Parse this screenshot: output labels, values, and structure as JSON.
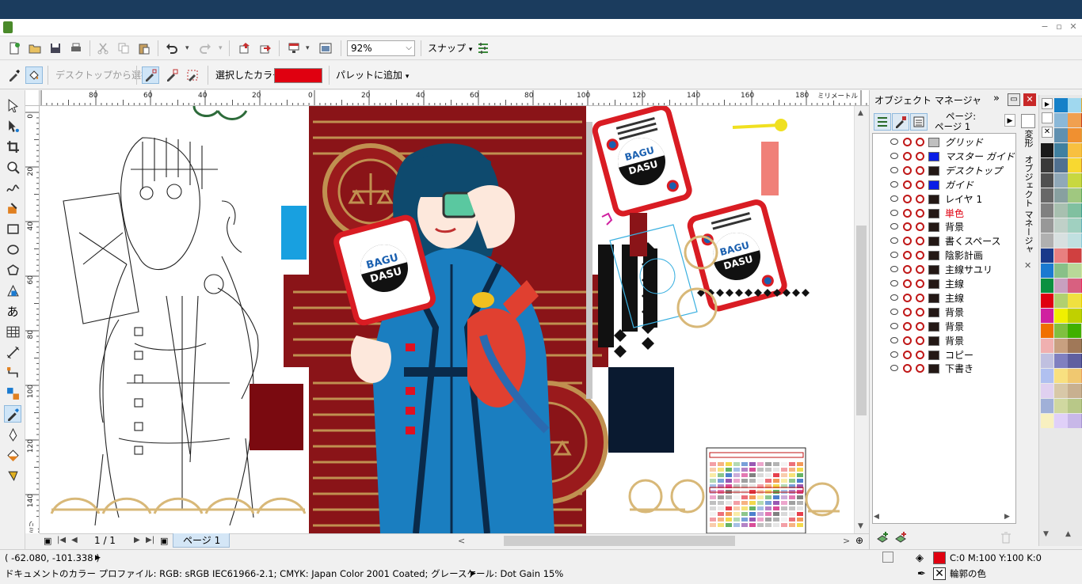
{
  "window": {
    "controls": [
      "−",
      "▫",
      "✕"
    ]
  },
  "toolbar": {
    "zoom": "92%",
    "snap_label": "スナップ"
  },
  "eyedropper_bar": {
    "desktop_select": "デスクトップから選択",
    "selected_color_label": "選択したカラー",
    "selected_color": "#e00010",
    "add_to_palette": "パレットに追加"
  },
  "ruler": {
    "h_ticks": [
      "80",
      "60",
      "40",
      "20",
      "0",
      "20",
      "40",
      "60",
      "80",
      "100",
      "120",
      "140",
      "160",
      "180"
    ],
    "h_unit": "ミリメートル",
    "v_ticks": [
      "0",
      "20",
      "40",
      "60",
      "80",
      "100",
      "120",
      "140"
    ],
    "v_unit": "ミリメートル"
  },
  "page_nav": {
    "counter": "1 / 1",
    "tab": "ページ 1"
  },
  "object_manager": {
    "title": "オブジェクト マネージャ",
    "page_header_line1": "ページ:",
    "page_header_line2": "ページ 1",
    "side_tab_1": "変形",
    "side_tab_2": "オブジェクト マネージャ",
    "layers": [
      {
        "name": "グリッド",
        "color": "#bfbfbf",
        "italic": true,
        "red": false
      },
      {
        "name": "マスター ガイド",
        "color": "#0a1ee6",
        "italic": true,
        "red": false
      },
      {
        "name": "デスクトップ",
        "color": "#231815",
        "italic": true,
        "red": false
      },
      {
        "name": "ガイド",
        "color": "#0a1ee6",
        "italic": true,
        "red": false
      },
      {
        "name": "レイヤ 1",
        "color": "#231815",
        "italic": false,
        "red": false
      },
      {
        "name": "単色",
        "color": "#231815",
        "italic": false,
        "red": true
      },
      {
        "name": "背景",
        "color": "#231815",
        "italic": false,
        "red": false
      },
      {
        "name": "書くスペース",
        "color": "#231815",
        "italic": false,
        "red": false
      },
      {
        "name": "陰影計画",
        "color": "#231815",
        "italic": false,
        "red": false
      },
      {
        "name": "主線サユリ",
        "color": "#231815",
        "italic": false,
        "red": false
      },
      {
        "name": "主線",
        "color": "#231815",
        "italic": false,
        "red": false
      },
      {
        "name": "主線",
        "color": "#231815",
        "italic": false,
        "red": false
      },
      {
        "name": "背景",
        "color": "#231815",
        "italic": false,
        "red": false
      },
      {
        "name": "背景",
        "color": "#231815",
        "italic": false,
        "red": false
      },
      {
        "name": "背景",
        "color": "#231815",
        "italic": false,
        "red": false
      },
      {
        "name": "コピー",
        "color": "#231815",
        "italic": false,
        "red": false
      },
      {
        "name": "下書き",
        "color": "#231815",
        "italic": false,
        "red": false
      }
    ]
  },
  "artwork": {
    "card_text_top": "BAGU",
    "card_text_bottom": "DASU"
  },
  "status": {
    "coordinates": "( -62.080, -101.338 )",
    "color_profile": "ドキュメントのカラー プロファイル: RGB: sRGB IEC61966-2.1; CMYK: Japan Color 2001 Coated; グレースケール: Dot Gain 15%",
    "fill_color": "#e00010",
    "fill_values": "C:0 M:100 Y:100 K:0",
    "outline_label": "輪郭の色"
  },
  "palette_colors": [
    "#ffffff",
    "#1580c8",
    "#a0d8ef",
    "#e0a830",
    "#2a2a2a",
    "#8ab8d8",
    "#f0a050",
    "#c84020",
    "#000000",
    "#6090b0",
    "#f09030",
    "#d8a040",
    "#1a1a1a",
    "#4080a0",
    "#f8c040",
    "#e8b030",
    "#3a3a3a",
    "#507090",
    "#f8d830",
    "#d09030",
    "#505050",
    "#90a8b8",
    "#c8d840",
    "#a0b830",
    "#686868",
    "#88a0a0",
    "#a0c880",
    "#60a860",
    "#808080",
    "#a8c0b0",
    "#80c0a0",
    "#40a090",
    "#989898",
    "#c0d0c8",
    "#a0d0c0",
    "#60b0b8",
    "#b0b0b0",
    "#d8e0e0",
    "#c0e0e0",
    "#88c8d8",
    "#1a3a8a",
    "#e88080",
    "#d04040",
    "#e0a0a0",
    "#1a7ad0",
    "#88c088",
    "#b8d898",
    "#d0e8a0",
    "#0a9040",
    "#c8a0c0",
    "#d86080",
    "#e83060",
    "#e00010",
    "#b0d070",
    "#f0e040",
    "#e8d000",
    "#d020a0",
    "#f0f000",
    "#c0d000",
    "#a0c000",
    "#f07000",
    "#80c040",
    "#40b000",
    "#e0e0c0",
    "#f0b0b0",
    "#c8a080",
    "#a07858",
    "#786040",
    "#c0c0e0",
    "#8080c0",
    "#6060a0",
    "#404080",
    "#b0c0f0",
    "#f8e080",
    "#f0c870",
    "#e8a060",
    "#e0d0f0",
    "#d8c8a8",
    "#c8b090",
    "#b09878",
    "#a0b0d8",
    "#d0d8a0",
    "#b8c888",
    "#9eb070",
    "#f8f0c0",
    "#e0d0f8",
    "#c8b8e8",
    "#a898d0"
  ]
}
